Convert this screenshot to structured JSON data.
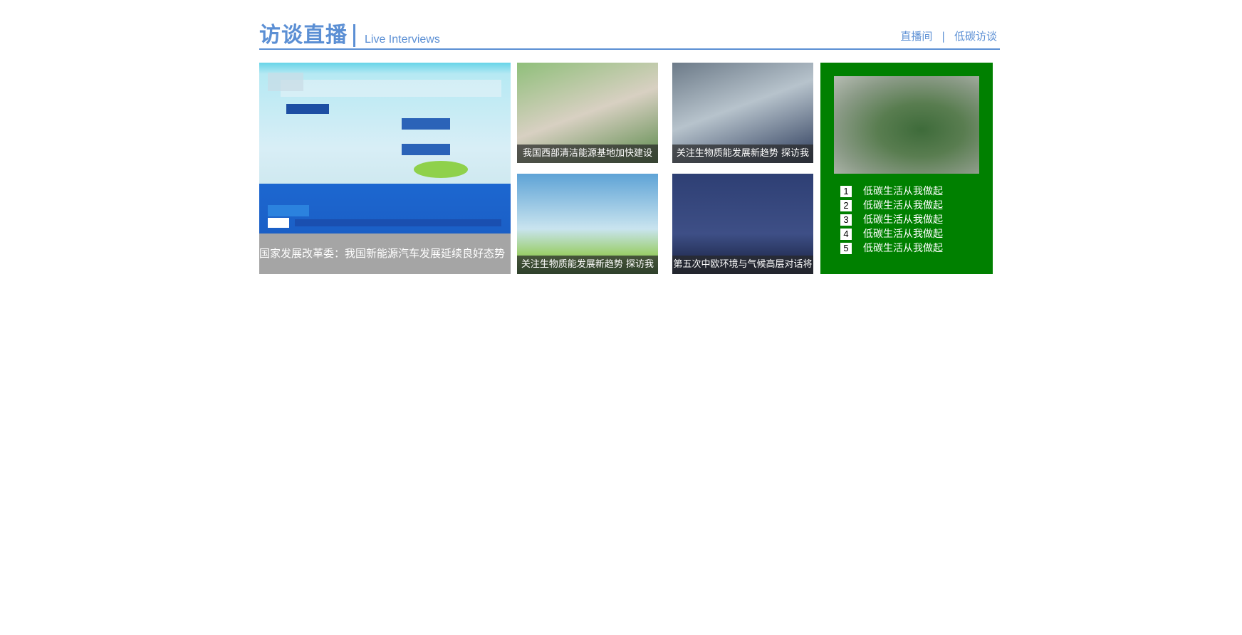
{
  "header": {
    "title": "访谈直播",
    "subtitle": "Live Interviews",
    "links": [
      "直播间",
      "低碳访谈"
    ],
    "separator": "|"
  },
  "feature": {
    "caption": "国家发展改革委：我国新能源汽车发展延续良好态势"
  },
  "thumbs": [
    {
      "caption": "我国西部清洁能源基地加快建设"
    },
    {
      "caption": "关注生物质能发展新趋势 探访我"
    },
    {
      "caption": "关注生物质能发展新趋势 探访我"
    },
    {
      "caption": "第五次中欧环境与气候高层对话将"
    }
  ],
  "sidebar": {
    "items": [
      {
        "num": "1",
        "label": "低碳生活从我做起"
      },
      {
        "num": "2",
        "label": "低碳生活从我做起"
      },
      {
        "num": "3",
        "label": "低碳生活从我做起"
      },
      {
        "num": "4",
        "label": "低碳生活从我做起"
      },
      {
        "num": "5",
        "label": "低碳生活从我做起"
      }
    ]
  },
  "colors": {
    "accent": "#5b8fd4",
    "sidebar_bg": "#008000",
    "caption_bg": "#a5a5a5"
  }
}
